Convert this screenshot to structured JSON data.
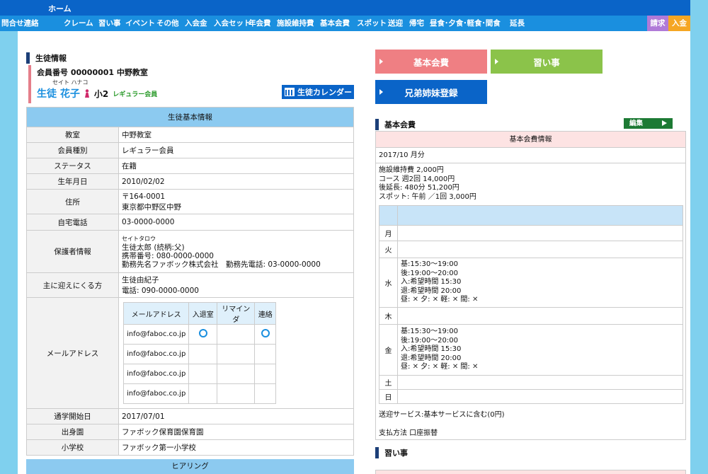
{
  "topbar": {
    "home": "ホーム"
  },
  "nav": {
    "items": [
      "問合せ連絡",
      "クレーム",
      "習い事",
      "イベント",
      "その他",
      "入会金",
      "入会セット",
      "年会費",
      "施設維持費",
      "基本会費",
      "スポット",
      "送迎",
      "帰宅",
      "昼食･夕食･軽食･間食",
      "延長"
    ],
    "bill": "請求",
    "pay": "入金"
  },
  "student": {
    "section_title": "生徒情報",
    "member_line": "会員番号 00000001 中野教室",
    "kana": "セイト ハナコ",
    "name": "生徒 花子",
    "grade": "小2",
    "member_type": "レギュラー会員",
    "calendar_button": "生徒カレンダー"
  },
  "basic_info": {
    "title": "生徒基本情報",
    "rows": [
      {
        "label": "教室",
        "value": "中野教室"
      },
      {
        "label": "会員種別",
        "value": "レギュラー会員"
      },
      {
        "label": "ステータス",
        "value": "在籍"
      },
      {
        "label": "生年月日",
        "value": "2010/02/02"
      },
      {
        "label": "住所",
        "line1": "〒164-0001",
        "line2": "東京都中野区中野"
      },
      {
        "label": "自宅電話",
        "value": "03-0000-0000"
      },
      {
        "label": "保護者情報",
        "kana": "セイトタロウ",
        "line1": "生徒太郎 (続柄:父)",
        "line2": "携帯番号: 080-0000-0000",
        "line3": "勤務先名ファボック株式会社　勤務先電話: 03-0000-0000"
      },
      {
        "label": "主に迎えにくる方",
        "line1": "生徒由紀子",
        "line2": "電話: 090-0000-0000"
      },
      {
        "label": "メールアドレス"
      },
      {
        "label": "通学開始日",
        "value": "2017/07/01"
      },
      {
        "label": "出身園",
        "value": "ファボック保育園保育園"
      },
      {
        "label": "小学校",
        "value": "ファボック第一小学校"
      }
    ],
    "mail_headers": [
      "メールアドレス",
      "入退室",
      "リマインダ",
      "連絡"
    ],
    "mails": [
      "info@faboc.co.jp",
      "info@faboc.co.jp",
      "info@faboc.co.jp",
      "info@faboc.co.jp"
    ],
    "hearing": "ヒアリング"
  },
  "right": {
    "btn_basic": "基本会費",
    "btn_lesson": "習い事",
    "btn_sibling": "兄弟姉妹登録",
    "fee_section": "基本会費",
    "edit": "編集",
    "fee_head": "基本会費情報",
    "month": "2017/10 月分",
    "fee_lines": [
      "施設維持費 2,000円",
      "コース 週2回 14,000円",
      "後延長: 480分 51,200円",
      "スポット: 午前 ／1回 3,000円"
    ],
    "days": [
      "月",
      "火",
      "水",
      "木",
      "金",
      "土",
      "日"
    ],
    "wed": [
      "基:15:30～19:00",
      "後:19:00～20:00",
      "入:希望時間 15:30",
      "退:希望時間 20:00"
    ],
    "fri": [
      "基:15:30～19:00",
      "後:19:00～20:00",
      "入:希望時間 15:30",
      "退:希望時間 20:00"
    ],
    "meal_labels": [
      "昼:",
      "夕:",
      "軽:",
      "間:"
    ],
    "x": "✕",
    "foot1": "送迎サービス:基本サービスに含む(0円)",
    "foot2": "支払方法 口座振替",
    "lesson_section": "習い事"
  },
  "colors": {
    "topbar": "#0a64c8",
    "nav": "#1a8fdf",
    "basic_btn": "#ef7f83",
    "lesson_btn": "#8bc34a",
    "sibling_btn": "#0a64c8"
  }
}
